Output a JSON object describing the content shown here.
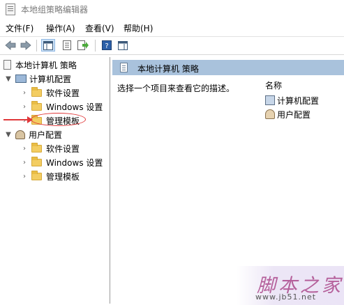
{
  "window": {
    "title": "本地组策略编辑器"
  },
  "menu": [
    "文件(F)",
    "操作(A)",
    "查看(V)",
    "帮助(H)"
  ],
  "toolbar": {
    "icons": [
      "back-icon",
      "forward-icon",
      "show-hide-tree-icon",
      "properties-icon",
      "export-list-icon",
      "help-icon",
      "show-pane-icon"
    ]
  },
  "tree": {
    "root": "本地计算机 策略",
    "computer": {
      "label": "计算机配置",
      "children": [
        "软件设置",
        "Windows 设置",
        "管理模板"
      ]
    },
    "user": {
      "label": "用户配置",
      "children": [
        "软件设置",
        "Windows 设置",
        "管理模板"
      ]
    }
  },
  "details": {
    "header": "本地计算机 策略",
    "description": "选择一个项目来查看它的描述。",
    "column_name": "名称",
    "items": [
      "计算机配置",
      "用户配置"
    ]
  },
  "annotation": {
    "color": "#e0383a"
  },
  "watermark": {
    "cn": "脚本之家",
    "url": "www.jb51.net"
  },
  "colors": {
    "header_bar": "#a9c2dc",
    "folder": "#f3cd62"
  }
}
